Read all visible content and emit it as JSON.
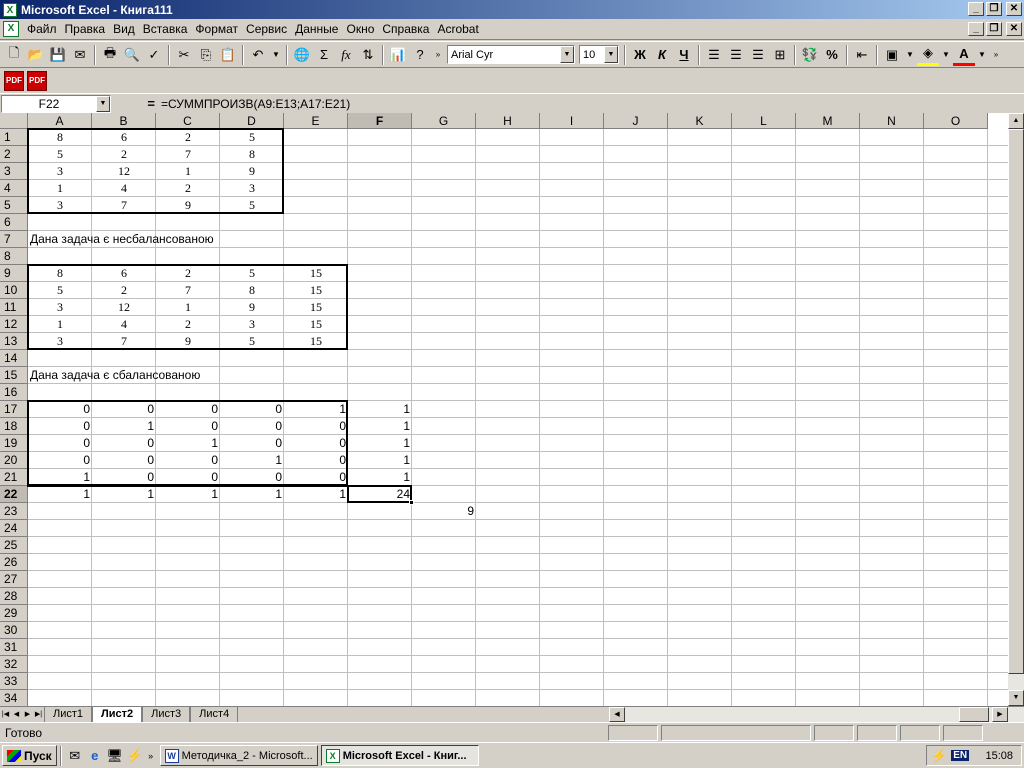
{
  "window": {
    "title": "Microsoft Excel - Книга111"
  },
  "menu": [
    "Файл",
    "Правка",
    "Вид",
    "Вставка",
    "Формат",
    "Сервис",
    "Данные",
    "Окно",
    "Справка",
    "Acrobat"
  ],
  "toolbar": {
    "font": "Arial Cyr",
    "size": "10"
  },
  "formula_bar": {
    "cell_ref": "F22",
    "eq": "=",
    "formula": "=СУММПРОИЗВ(A9:E13;A17:E21)"
  },
  "columns": [
    "A",
    "B",
    "C",
    "D",
    "E",
    "F",
    "G",
    "H",
    "I",
    "J",
    "K",
    "L",
    "M",
    "N",
    "O"
  ],
  "rows": [
    "1",
    "2",
    "3",
    "4",
    "5",
    "6",
    "7",
    "8",
    "9",
    "10",
    "11",
    "12",
    "13",
    "14",
    "15",
    "16",
    "17",
    "18",
    "19",
    "20",
    "21",
    "22",
    "23",
    "24",
    "25",
    "26",
    "27",
    "28",
    "29",
    "30",
    "31",
    "32",
    "33",
    "34"
  ],
  "table1": [
    [
      "8",
      "6",
      "2",
      "5"
    ],
    [
      "5",
      "2",
      "7",
      "8"
    ],
    [
      "3",
      "12",
      "1",
      "9"
    ],
    [
      "1",
      "4",
      "2",
      "3"
    ],
    [
      "3",
      "7",
      "9",
      "5"
    ]
  ],
  "note1": "Дана задача є несбалансованою",
  "table2": [
    [
      "8",
      "6",
      "2",
      "5",
      "15"
    ],
    [
      "5",
      "2",
      "7",
      "8",
      "15"
    ],
    [
      "3",
      "12",
      "1",
      "9",
      "15"
    ],
    [
      "1",
      "4",
      "2",
      "3",
      "15"
    ],
    [
      "3",
      "7",
      "9",
      "5",
      "15"
    ]
  ],
  "note2": "Дана задача є сбалансованою",
  "table3": [
    [
      "0",
      "0",
      "0",
      "0",
      "1",
      "1"
    ],
    [
      "0",
      "1",
      "0",
      "0",
      "0",
      "1"
    ],
    [
      "0",
      "0",
      "1",
      "0",
      "0",
      "1"
    ],
    [
      "0",
      "0",
      "0",
      "1",
      "0",
      "1"
    ],
    [
      "1",
      "0",
      "0",
      "0",
      "0",
      "1"
    ]
  ],
  "row22": [
    "1",
    "1",
    "1",
    "1",
    "1",
    "24"
  ],
  "g23": "9",
  "sheet_tabs": [
    "Лист1",
    "Лист2",
    "Лист3",
    "Лист4"
  ],
  "active_tab_index": 1,
  "status": "Готово",
  "taskbar": {
    "start": "Пуск",
    "task1": "Методичка_2 - Microsoft...",
    "task2": "Microsoft Excel - Книг...",
    "lang": "EN",
    "clock": "15:08"
  }
}
